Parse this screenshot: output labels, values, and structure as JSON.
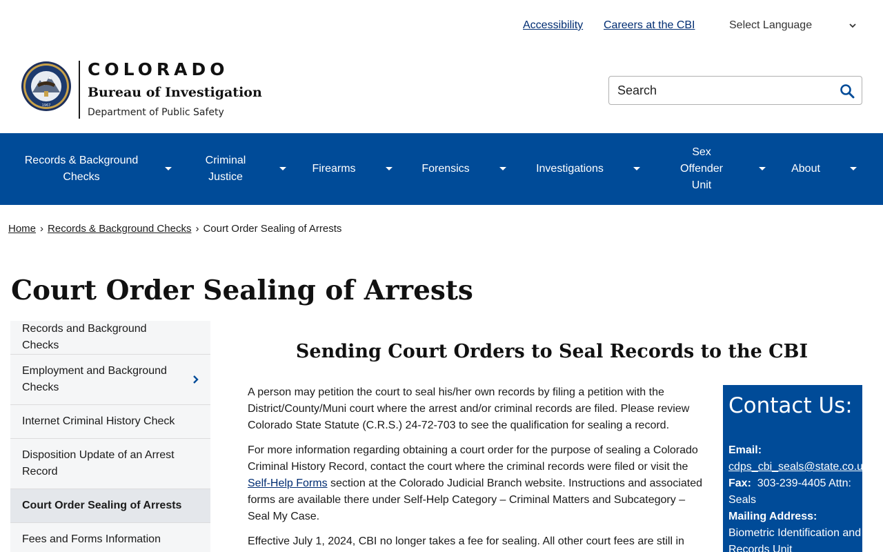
{
  "utility": {
    "accessibility": "Accessibility",
    "careers": "Careers at the CBI",
    "language": "Select Language"
  },
  "logo": {
    "state": "COLORADO",
    "bureau": "Bureau of Investigation",
    "department": "Department of Public Safety",
    "seal_year": "1967"
  },
  "search": {
    "placeholder": "Search"
  },
  "nav": {
    "items": [
      {
        "label": "Records & Background Checks"
      },
      {
        "label": "Criminal Justice"
      },
      {
        "label": "Firearms"
      },
      {
        "label": "Forensics"
      },
      {
        "label": "Investigations"
      },
      {
        "label": "Sex Offender Unit"
      },
      {
        "label": "About"
      }
    ]
  },
  "breadcrumb": {
    "home": "Home",
    "parent": "Records & Background Checks",
    "current": "Court Order Sealing of Arrests",
    "separator": "›"
  },
  "page_title": "Court Order Sealing of Arrests",
  "sidebar": {
    "items": [
      {
        "label": "Records and Background Checks"
      },
      {
        "label": "Employment and Background Checks"
      },
      {
        "label": "Internet Criminal History Check"
      },
      {
        "label": "Disposition Update of an Arrest Record"
      },
      {
        "label": "Court Order Sealing of Arrests"
      },
      {
        "label": "Fees and Forms Information"
      }
    ],
    "active_index": 4
  },
  "content": {
    "heading": "Sending Court Orders to Seal Records to the CBI",
    "p1": "A person may petition the court to seal his/her own records by filing a petition with the District/County/Muni court where the arrest and/or criminal records are filed. Please review Colorado State Statute (C.R.S.) 24-72-703 to see the qualification for sealing a record.",
    "p2_before": "For more information regarding obtaining a court order for the purpose of sealing a Colorado Criminal History Record, contact the court where the criminal records were filed or visit the ",
    "p2_link": "Self-Help Forms",
    "p2_after": " section at the Colorado Judicial Branch website. Instructions and associated forms are available there under Self-Help Category – Criminal Matters and Subcategory – Seal My Case.",
    "p3": "Effective July 1, 2024, CBI no longer takes a fee for sealing.  All other court fees are still in"
  },
  "contact": {
    "title": "Contact Us:",
    "email_label": "Email:",
    "email": "cdps_cbi_seals@state.co.us",
    "fax_label": "Fax:",
    "fax": "303-239-4405 Attn: Seals",
    "mail_label": "Mailing Address:",
    "mail_line1": "Biometric Identification and Records Unit"
  },
  "colors": {
    "nav_blue": "#004b98",
    "link_blue": "#002d72",
    "sidebar_bg": "#f5f6f7",
    "sidebar_active": "#e4e7eb"
  }
}
